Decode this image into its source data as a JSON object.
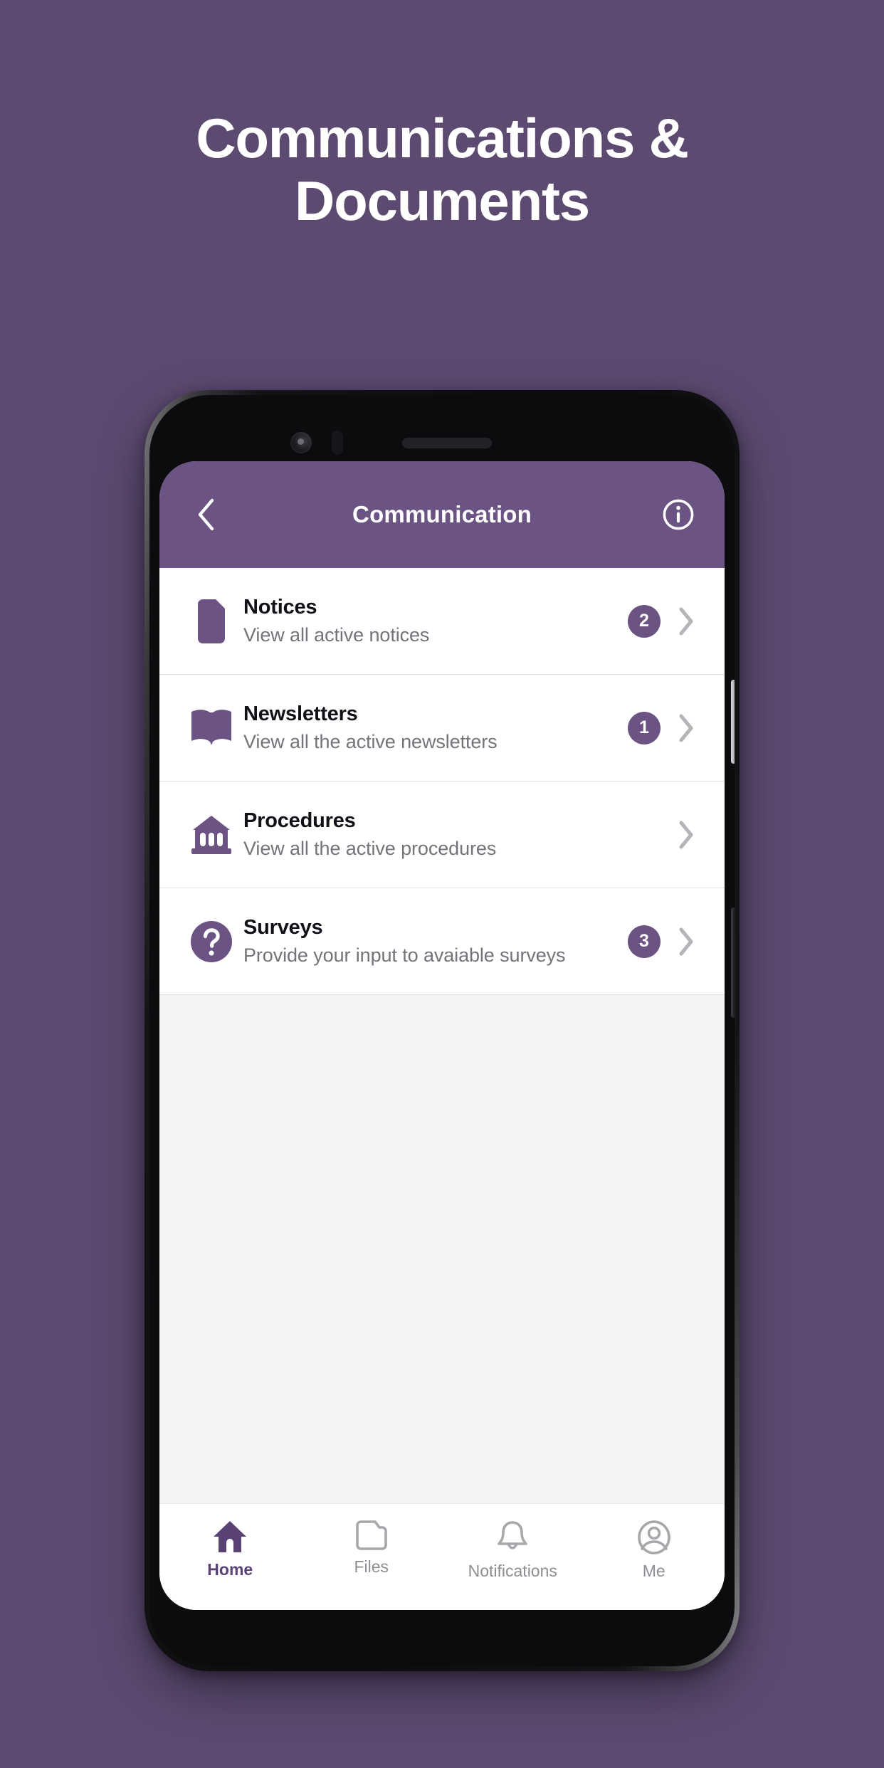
{
  "poster": {
    "background_color": "#5d4a71",
    "headline_lines": [
      "Communications &",
      "Documents"
    ]
  },
  "app": {
    "accent_color": "#6b5383",
    "screen_background": "#f4f4f5",
    "appbar": {
      "title": "Communication",
      "back_icon": "chevron-left-icon",
      "info_icon": "info-circle-icon"
    },
    "list": [
      {
        "icon": "document-icon",
        "title": "Notices",
        "subtitle": "View all active notices",
        "badge": "2",
        "chevron": "chevron-right-icon"
      },
      {
        "icon": "open-book-icon",
        "title": "Newsletters",
        "subtitle": "View all the active newsletters",
        "badge": "1",
        "chevron": "chevron-right-icon"
      },
      {
        "icon": "bank-icon",
        "title": "Procedures",
        "subtitle": "View all the active procedures",
        "badge": "",
        "chevron": "chevron-right-icon"
      },
      {
        "icon": "question-mark-circle-icon",
        "title": "Surveys",
        "subtitle": "Provide your input to avaiable surveys",
        "badge": "3",
        "chevron": "chevron-right-icon"
      }
    ],
    "bottom_nav": {
      "active_index": 0,
      "items": [
        {
          "icon": "home-icon",
          "label": "Home"
        },
        {
          "icon": "folder-icon",
          "label": "Files"
        },
        {
          "icon": "bell-icon",
          "label": "Notifications"
        },
        {
          "icon": "account-circle-icon",
          "label": "Me"
        }
      ]
    }
  }
}
